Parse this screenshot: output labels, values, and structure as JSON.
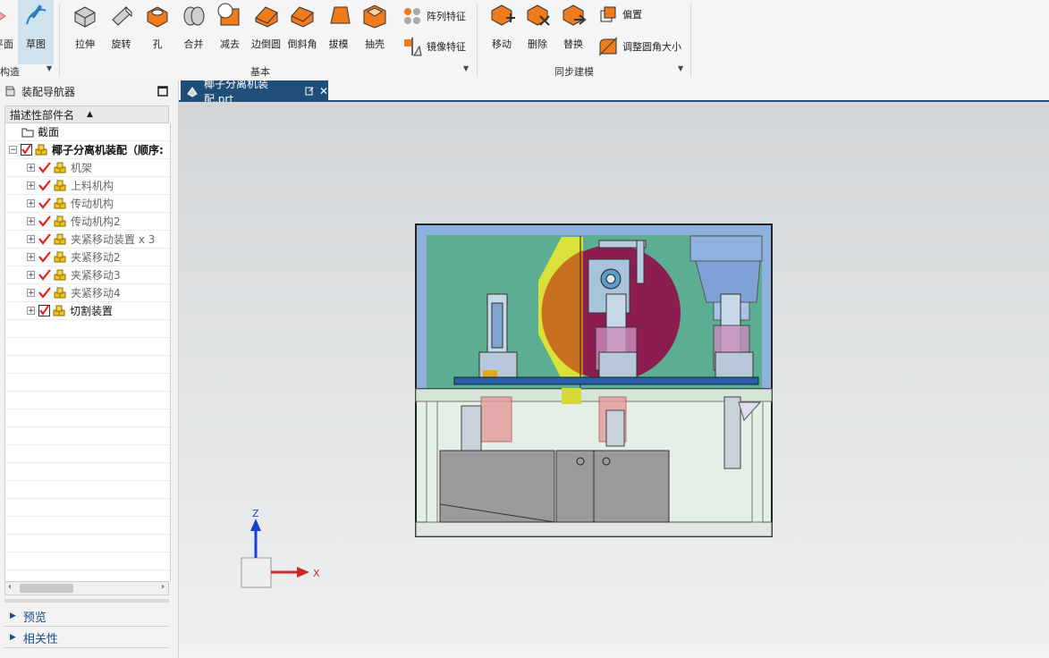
{
  "ribbon": {
    "edge_left_label": "平面",
    "sketch_label": "草图",
    "group_left_label": "构造",
    "basic": {
      "buttons": [
        {
          "label": "拉伸",
          "icon": "extrude-icon"
        },
        {
          "label": "旋转",
          "icon": "revolve-icon"
        },
        {
          "label": "孔",
          "icon": "hole-icon"
        },
        {
          "label": "合并",
          "icon": "unite-icon"
        },
        {
          "label": "减去",
          "icon": "subtract-icon"
        },
        {
          "label": "边倒圆",
          "icon": "edge-blend-icon"
        },
        {
          "label": "倒斜角",
          "icon": "chamfer-icon"
        },
        {
          "label": "拔模",
          "icon": "draft-icon"
        },
        {
          "label": "抽壳",
          "icon": "shell-icon"
        }
      ],
      "small": [
        {
          "label": "阵列特征",
          "icon": "pattern-feature-icon"
        },
        {
          "label": "镜像特征",
          "icon": "mirror-feature-icon"
        }
      ],
      "group_label": "基本"
    },
    "sync": {
      "buttons": [
        {
          "label": "移动",
          "icon": "move-face-icon"
        },
        {
          "label": "删除",
          "icon": "delete-face-icon"
        },
        {
          "label": "替换",
          "icon": "replace-face-icon"
        }
      ],
      "small": [
        {
          "label": "偏置",
          "icon": "offset-region-icon"
        },
        {
          "label": "调整圆角大小",
          "icon": "resize-blend-icon"
        }
      ],
      "group_label": "同步建模"
    }
  },
  "navigator": {
    "title": "装配导航器",
    "column_header": "描述性部件名",
    "items": [
      {
        "label": "截面",
        "level": 0,
        "type": "folder",
        "bold": false
      },
      {
        "label": "椰子分离机装配（顺序:",
        "level": 0,
        "type": "assembly",
        "bold": true
      },
      {
        "label": "机架",
        "level": 1,
        "type": "component",
        "bold": false
      },
      {
        "label": "上料机构",
        "level": 1,
        "type": "component",
        "bold": false
      },
      {
        "label": "传动机构",
        "level": 1,
        "type": "component",
        "bold": false
      },
      {
        "label": "传动机构2",
        "level": 1,
        "type": "component",
        "bold": false
      },
      {
        "label": "夹紧移动装置 x 3",
        "level": 1,
        "type": "component",
        "bold": false
      },
      {
        "label": "夹紧移动2",
        "level": 1,
        "type": "component",
        "bold": false
      },
      {
        "label": "夹紧移动3",
        "level": 1,
        "type": "component",
        "bold": false
      },
      {
        "label": "夹紧移动4",
        "level": 1,
        "type": "component",
        "bold": false
      },
      {
        "label": "切割装置",
        "level": 1,
        "type": "component-box",
        "bold": false
      }
    ],
    "preview_label": "预览",
    "relations_label": "相关性"
  },
  "document": {
    "tab_title": "椰子分离机装配.prt"
  },
  "triad": {
    "z_label": "Z",
    "x_label": "X"
  },
  "colors": {
    "accent": "#1f4e79",
    "check": "#e0201b",
    "orange": "#f07b1c"
  }
}
